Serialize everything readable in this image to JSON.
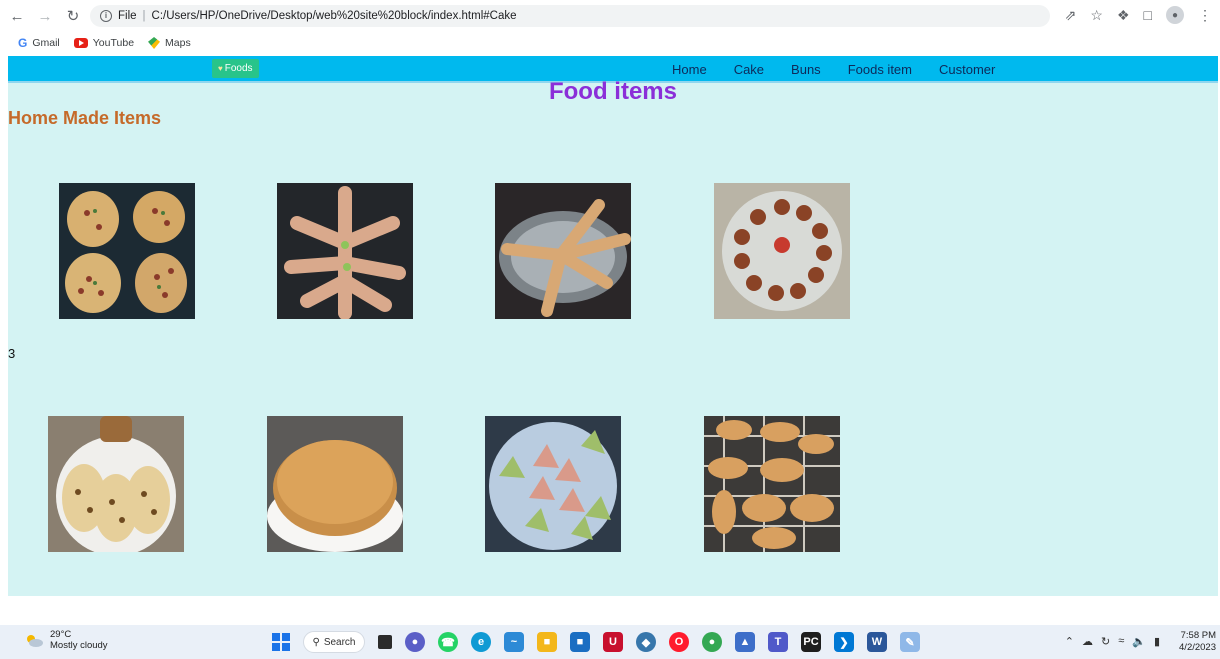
{
  "browser": {
    "url_prefix": "File",
    "url": "C:/Users/HP/OneDrive/Desktop/web%20site%20block/index.html#Cake",
    "bookmarks": [
      {
        "label": "Gmail"
      },
      {
        "label": "YouTube"
      },
      {
        "label": "Maps"
      }
    ]
  },
  "site": {
    "brand": "Foods",
    "nav": [
      "Home",
      "Cake",
      "Buns",
      "Foods item",
      "Customer"
    ],
    "title": "Food items",
    "section_heading": "Home Made Items",
    "stray_text": "3",
    "images_row1": [
      "pizza-icon",
      "twist-bread-icon",
      "bread-sticks-icon",
      "fried-balls-icon"
    ],
    "images_row2": [
      "naan-icon",
      "sponge-cake-icon",
      "dumplings-icon",
      "eclairs-icon"
    ]
  },
  "taskbar": {
    "temperature": "29°C",
    "weather": "Mostly cloudy",
    "search_label": "Search",
    "time": "7:58 PM",
    "date": "4/2/2023"
  }
}
